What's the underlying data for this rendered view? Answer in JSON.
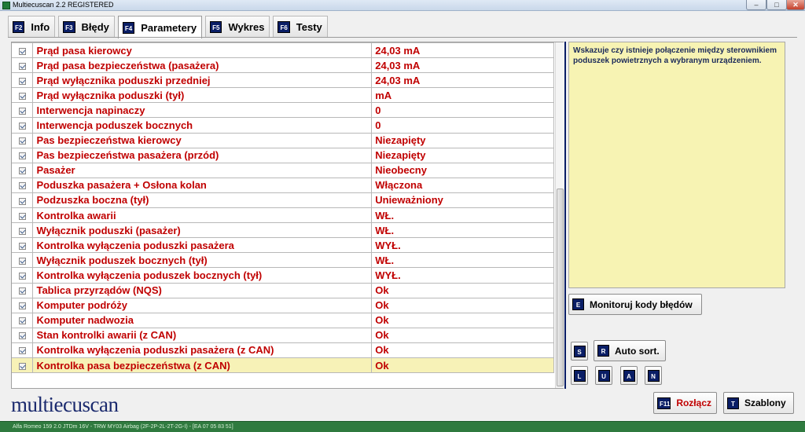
{
  "window": {
    "title": "Multiecuscan 2.2 REGISTERED",
    "minimize_glyph": "–",
    "maximize_glyph": "□",
    "close_glyph": "✕"
  },
  "tabs": [
    {
      "key": "F2",
      "label": "Info",
      "active": false
    },
    {
      "key": "F3",
      "label": "Błędy",
      "active": false
    },
    {
      "key": "F4",
      "label": "Parametery",
      "active": true
    },
    {
      "key": "F5",
      "label": "Wykres",
      "active": false
    },
    {
      "key": "F6",
      "label": "Testy",
      "active": false
    }
  ],
  "parameters": [
    {
      "name": "Prąd pasa kierowcy",
      "value": "24,03 mA",
      "checked": true
    },
    {
      "name": "Prąd pasa bezpieczeństwa (pasażera)",
      "value": "24,03 mA",
      "checked": true
    },
    {
      "name": "Prąd wyłącznika poduszki przedniej",
      "value": "24,03 mA",
      "checked": true
    },
    {
      "name": "Prąd wyłącznika poduszki (tył)",
      "value": " mA",
      "checked": true
    },
    {
      "name": "Interwencja napinaczy",
      "value": "0",
      "checked": true
    },
    {
      "name": "Interwencja poduszek bocznych",
      "value": "0",
      "checked": true
    },
    {
      "name": "Pas bezpieczeństwa kierowcy",
      "value": "Niezapięty",
      "checked": true
    },
    {
      "name": "Pas bezpieczeństwa pasażera (przód)",
      "value": "Niezapięty",
      "checked": true
    },
    {
      "name": "Pasażer",
      "value": "Nieobecny",
      "checked": true
    },
    {
      "name": "Poduszka pasażera + Osłona kolan",
      "value": "Włączona",
      "checked": true
    },
    {
      "name": "Podzuszka boczna (tył)",
      "value": "Unieważniony",
      "checked": true
    },
    {
      "name": "Kontrolka awarii",
      "value": "WŁ.",
      "checked": true
    },
    {
      "name": "Wyłącznik poduszki (pasażer)",
      "value": "WŁ.",
      "checked": true
    },
    {
      "name": "Kontrolka wyłączenia poduszki pasażera",
      "value": "WYŁ.",
      "checked": true
    },
    {
      "name": "Wyłącznik poduszek bocznych (tył)",
      "value": "WŁ.",
      "checked": true
    },
    {
      "name": "Kontrolka wyłączenia poduszek bocznych (tył)",
      "value": "WYŁ.",
      "checked": true
    },
    {
      "name": "Tablica przyrządów (NQS)",
      "value": "Ok",
      "checked": true
    },
    {
      "name": "Komputer podróży",
      "value": "Ok",
      "checked": true
    },
    {
      "name": "Komputer nadwozia",
      "value": "Ok",
      "checked": true
    },
    {
      "name": "Stan kontrolki awarii (z CAN)",
      "value": "Ok",
      "checked": true
    },
    {
      "name": "Kontrolka wyłączenia poduszki pasażera (z CAN)",
      "value": "Ok",
      "checked": true
    },
    {
      "name": "Kontrolka pasa bezpieczeństwa (z CAN)",
      "value": "Ok",
      "checked": true,
      "selected": true
    }
  ],
  "description": "Wskazuje czy istnieje połączenie między sterownikiem poduszek powietrznych a wybranym urządzeniem.",
  "buttons": {
    "monitor": {
      "key": "E",
      "label": "Monitoruj kody błędów"
    },
    "s": {
      "key": "S"
    },
    "auto_sort": {
      "key": "R",
      "label": "Auto sort."
    },
    "l": {
      "key": "L"
    },
    "u": {
      "key": "U"
    },
    "a": {
      "key": "A"
    },
    "n": {
      "key": "N"
    },
    "disconnect": {
      "key": "F11",
      "label": "Rozłącz"
    },
    "templates": {
      "key": "T",
      "label": "Szablony"
    }
  },
  "logo": "multiecuscan",
  "status": "Alfa Romeo 159 2.0 JTDm 16V - TRW MY03 Airbag (2F-2P-2L-2T-2G-I) - [EA 07 05 83 51]",
  "colors": {
    "value_text": "#c00000",
    "key_badge": "#0a1e66",
    "description_bg": "#f7f3b3",
    "selected_row_bg": "#f7f2b7",
    "status_bar": "#2f7a3f"
  }
}
